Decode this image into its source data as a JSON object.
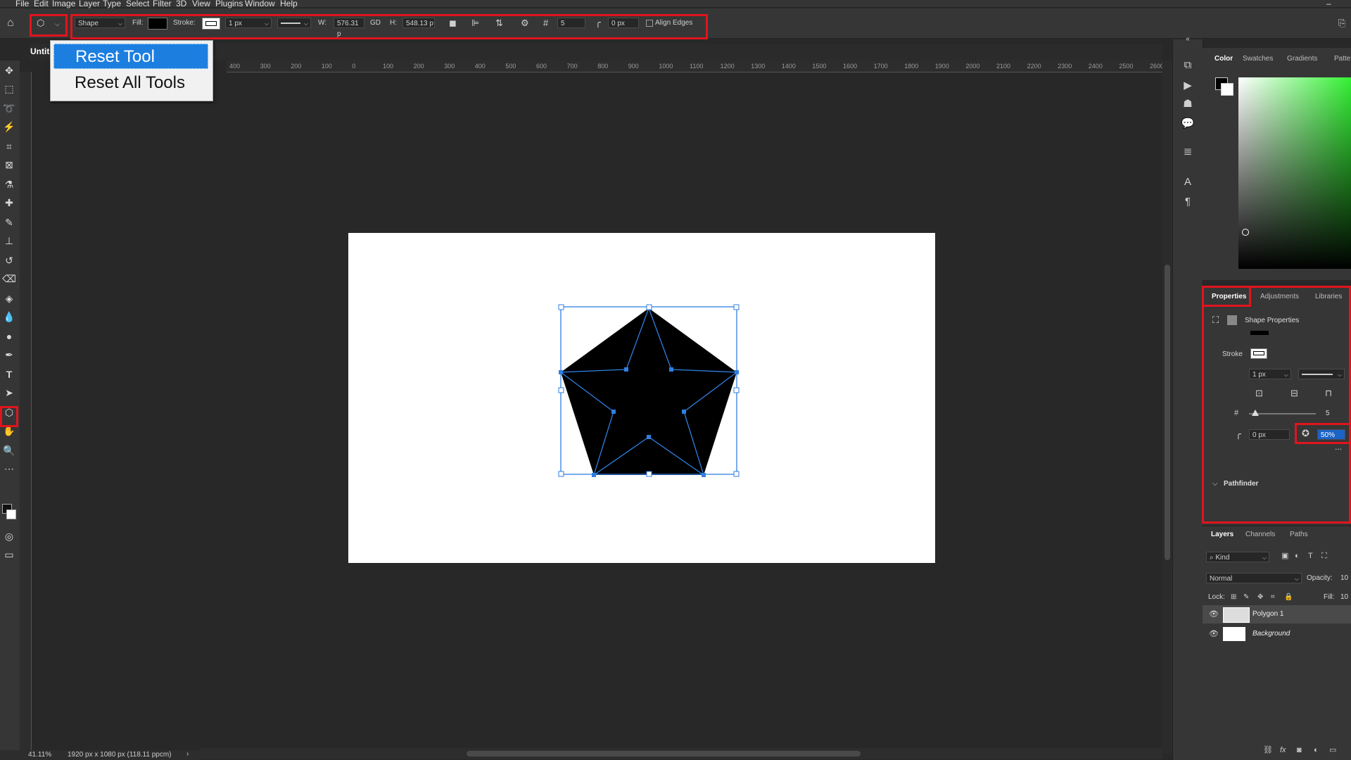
{
  "menu": {
    "items": [
      "File",
      "Edit",
      "Image",
      "Layer",
      "Type",
      "Select",
      "Filter",
      "3D",
      "View",
      "Plugins",
      "Window",
      "Help"
    ],
    "minimize": "–"
  },
  "options": {
    "mode": "Shape",
    "fill_label": "Fill:",
    "stroke_label": "Stroke:",
    "stroke_width": "1 px",
    "w_label": "W:",
    "w_value": "576.31 p",
    "link": "GD",
    "h_label": "H:",
    "h_value": "548.13 p",
    "sides_value": "5",
    "radius_value": "0 px",
    "align_edges": "Align Edges"
  },
  "doc_tab": "Untit",
  "tool_menu": {
    "items": [
      "Reset Tool",
      "Reset All Tools"
    ]
  },
  "ruler": {
    "labels": [
      "400",
      "300",
      "200",
      "100",
      "0",
      "100",
      "200",
      "300",
      "400",
      "500",
      "600",
      "700",
      "800",
      "900",
      "1000",
      "1100",
      "1200",
      "1300",
      "1400",
      "1500",
      "1600",
      "1700",
      "1800",
      "1900",
      "2000",
      "2100",
      "2200",
      "2300",
      "2400",
      "2500",
      "2600"
    ]
  },
  "status": {
    "zoom": "41.11%",
    "doc_info": "1920 px x 1080 px (118.11 ppcm)"
  },
  "color_panel": {
    "tabs": [
      "Color",
      "Swatches",
      "Gradients",
      "Patte"
    ]
  },
  "properties": {
    "tabs": [
      "Properties",
      "Adjustments",
      "Libraries"
    ],
    "title": "Shape Properties",
    "stroke_label": "Stroke",
    "stroke_width": "1 px",
    "sides": "5",
    "radius": "0 px",
    "star_ratio": "50%",
    "pathfinder": "Pathfinder",
    "more": "..."
  },
  "layers": {
    "tabs": [
      "Layers",
      "Channels",
      "Paths"
    ],
    "filter": "Kind",
    "blend": "Normal",
    "opacity_label": "Opacity:",
    "opacity_value": "10",
    "lock_label": "Lock:",
    "fill_label": "Fill:",
    "fill_value": "10",
    "items": [
      {
        "name": "Polygon 1"
      },
      {
        "name": "Background"
      }
    ]
  },
  "colors": {
    "accent_red": "#e0141d",
    "selection_blue": "#1c7fe0",
    "path_blue": "#2f7fe0"
  }
}
